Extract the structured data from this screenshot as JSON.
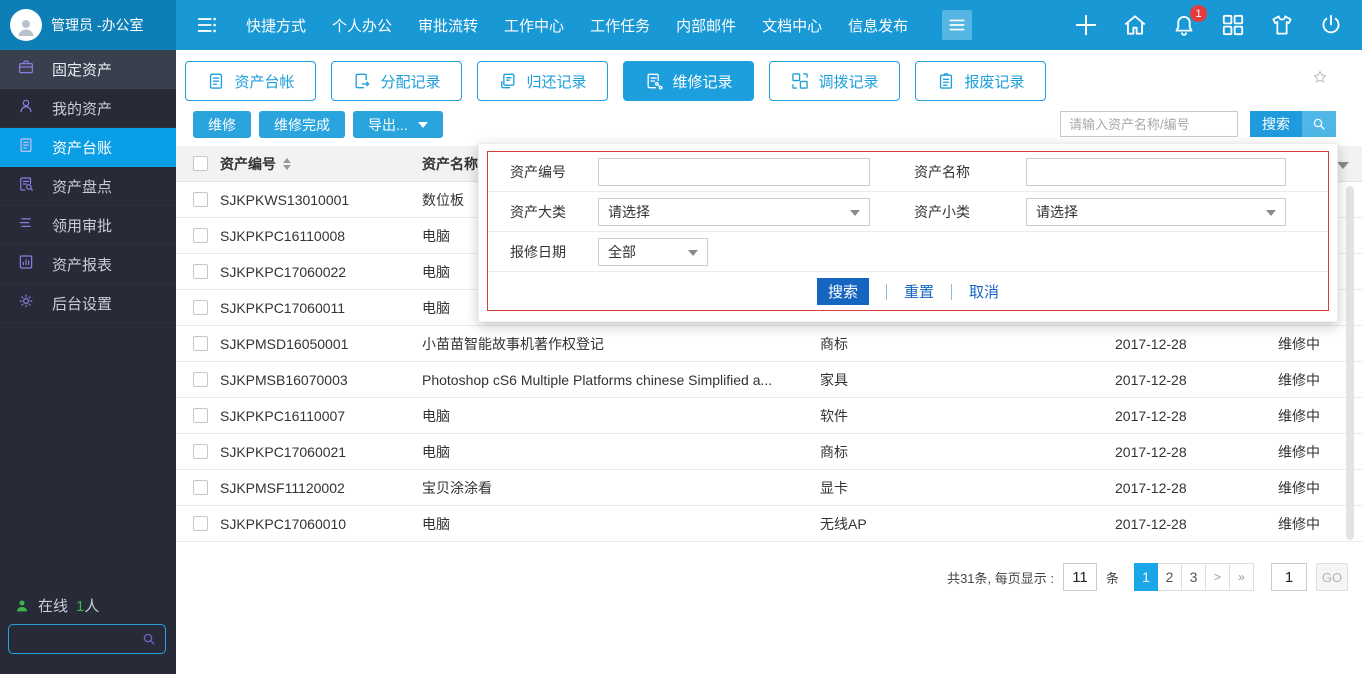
{
  "topbar": {
    "user_name": "管理员 -办公室",
    "nav": [
      "快捷方式",
      "个人办公",
      "审批流转",
      "工作中心",
      "工作任务",
      "内部邮件",
      "文档中心",
      "信息发布"
    ],
    "notification_badge": "1",
    "action_icons": [
      "plus-icon",
      "home-icon",
      "bell-icon",
      "apps-icon",
      "shirt-icon",
      "power-icon"
    ]
  },
  "sidebar": {
    "items": [
      {
        "key": "fixed-assets",
        "label": "固定资产",
        "icon": "briefcase-icon",
        "type": "group"
      },
      {
        "key": "my-assets",
        "label": "我的资产",
        "icon": "person-icon"
      },
      {
        "key": "asset-ledger",
        "label": "资产台账",
        "icon": "ledger-icon",
        "active": true
      },
      {
        "key": "asset-inventory",
        "label": "资产盘点",
        "icon": "doc-search-icon"
      },
      {
        "key": "requisition-approval",
        "label": "领用审批",
        "icon": "stack-icon"
      },
      {
        "key": "asset-reports",
        "label": "资产报表",
        "icon": "report-icon"
      },
      {
        "key": "admin-settings",
        "label": "后台设置",
        "icon": "gear-icon"
      }
    ],
    "online_label": "在线",
    "online_count": "1",
    "online_unit": "人"
  },
  "tabs": [
    {
      "key": "asset-ledger",
      "label": "资产台帐",
      "icon": "ledger-icon"
    },
    {
      "key": "allocation-records",
      "label": "分配记录",
      "icon": "doc-assign-icon"
    },
    {
      "key": "return-records",
      "label": "归还记录",
      "icon": "doc-return-icon"
    },
    {
      "key": "repair-records",
      "label": "维修记录",
      "icon": "doc-repair-icon",
      "active": true
    },
    {
      "key": "transfer-records",
      "label": "调拨记录",
      "icon": "transfer-icon"
    },
    {
      "key": "scrap-records",
      "label": "报废记录",
      "icon": "clipboard-icon"
    }
  ],
  "toolbar": {
    "buttons": [
      {
        "key": "repair",
        "label": "维修"
      },
      {
        "key": "repair-done",
        "label": "维修完成"
      },
      {
        "key": "export",
        "label": "导出...",
        "caret": true
      }
    ],
    "search_placeholder": "请输入资产名称/编号",
    "search_label": "搜索"
  },
  "filter_popup": {
    "asset_code_label": "资产编号",
    "asset_name_label": "资产名称",
    "category_label": "资产大类",
    "subcategory_label": "资产小类",
    "date_label": "报修日期",
    "select_placeholder": "请选择",
    "date_value": "全部",
    "search_label": "搜索",
    "reset_label": "重置",
    "cancel_label": "取消"
  },
  "table": {
    "headers": {
      "code": "资产编号",
      "name": "资产名称"
    },
    "rows": [
      {
        "code": "SJKPKWS13010001",
        "name": "数位板",
        "category": "",
        "date": "",
        "status": ""
      },
      {
        "code": "SJKPKPC16110008",
        "name": "电脑",
        "category": "",
        "date": "",
        "status": ""
      },
      {
        "code": "SJKPKPC17060022",
        "name": "电脑",
        "category": "",
        "date": "",
        "status": ""
      },
      {
        "code": "SJKPKPC17060011",
        "name": "电脑",
        "category": "",
        "date": "",
        "status": ""
      },
      {
        "code": "SJKPMSD16050001",
        "name": "小苗苗智能故事机著作权登记",
        "category": "商标",
        "date": "2017-12-28",
        "status": "维修中"
      },
      {
        "code": "SJKPMSB16070003",
        "name": "Photoshop cS6 Multiple Platforms chinese Simplified a...",
        "category": "家具",
        "date": "2017-12-28",
        "status": "维修中"
      },
      {
        "code": "SJKPKPC16110007",
        "name": "电脑",
        "category": "软件",
        "date": "2017-12-28",
        "status": "维修中"
      },
      {
        "code": "SJKPKPC17060021",
        "name": "电脑",
        "category": "商标",
        "date": "2017-12-28",
        "status": "维修中"
      },
      {
        "code": "SJKPMSF11120002",
        "name": "宝贝涂涂看",
        "category": "显卡",
        "date": "2017-12-28",
        "status": "维修中"
      },
      {
        "code": "SJKPKPC17060010",
        "name": "电脑",
        "category": "无线AP",
        "date": "2017-12-28",
        "status": "维修中"
      }
    ]
  },
  "pagination": {
    "total_text": "共31条, 每页显示 :",
    "per_page": "11",
    "unit": "条",
    "pages": [
      {
        "label": "1",
        "active": true
      },
      {
        "label": "2"
      },
      {
        "label": "3"
      },
      {
        "label": ">",
        "arrow": true
      },
      {
        "label": "»",
        "arrow": true
      }
    ],
    "jump_value": "1",
    "go_label": "GO"
  },
  "colors": {
    "topbar": "#1898d5",
    "topbar_user": "#0e7fb6",
    "sidebar": "#272b38",
    "active_item": "#0a9ee6",
    "accent": "#1e9fdd",
    "popup_border": "#dd3c3c",
    "popup_button": "#1666c1",
    "badge": "#e23c3c",
    "online_green": "#3bb54a"
  }
}
